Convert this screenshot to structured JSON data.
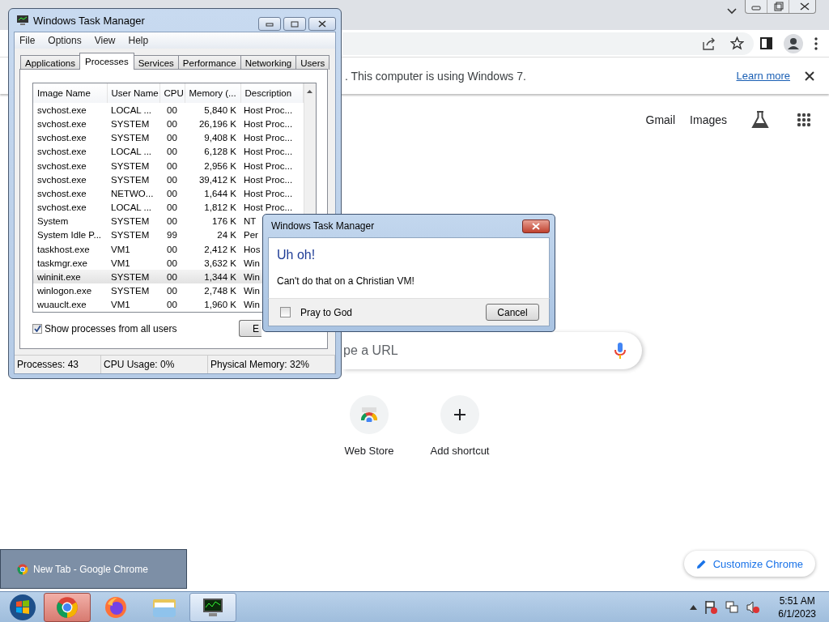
{
  "chrome": {
    "infobar": {
      "message": ". This computer is using Windows 7.",
      "link": "Learn more"
    },
    "top_links": [
      "Gmail",
      "Images"
    ],
    "search": {
      "placeholder": "pe a URL"
    },
    "shortcuts": [
      {
        "label": "Web Store",
        "kind": "webstore"
      },
      {
        "label": "Add shortcut",
        "kind": "add"
      }
    ],
    "customize_button": "Customize Chrome"
  },
  "task_manager": {
    "title": "Windows Task Manager",
    "menu": [
      "File",
      "Options",
      "View",
      "Help"
    ],
    "tabs": [
      {
        "label": "Applications",
        "selected": false
      },
      {
        "label": "Processes",
        "selected": true
      },
      {
        "label": "Services",
        "selected": false
      },
      {
        "label": "Performance",
        "selected": false
      },
      {
        "label": "Networking",
        "selected": false
      },
      {
        "label": "Users",
        "selected": false
      }
    ],
    "columns": [
      "Image Name",
      "User Name",
      "CPU",
      "Memory (...",
      "Description"
    ],
    "rows": [
      {
        "cells": [
          "svchost.exe",
          "LOCAL ...",
          "00",
          "5,840 K",
          "Host Proc..."
        ],
        "selected": false
      },
      {
        "cells": [
          "svchost.exe",
          "SYSTEM",
          "00",
          "26,196 K",
          "Host Proc..."
        ],
        "selected": false
      },
      {
        "cells": [
          "svchost.exe",
          "SYSTEM",
          "00",
          "9,408 K",
          "Host Proc..."
        ],
        "selected": false
      },
      {
        "cells": [
          "svchost.exe",
          "LOCAL ...",
          "00",
          "6,128 K",
          "Host Proc..."
        ],
        "selected": false
      },
      {
        "cells": [
          "svchost.exe",
          "SYSTEM",
          "00",
          "2,956 K",
          "Host Proc..."
        ],
        "selected": false
      },
      {
        "cells": [
          "svchost.exe",
          "SYSTEM",
          "00",
          "39,412 K",
          "Host Proc..."
        ],
        "selected": false
      },
      {
        "cells": [
          "svchost.exe",
          "NETWO...",
          "00",
          "1,644 K",
          "Host Proc..."
        ],
        "selected": false
      },
      {
        "cells": [
          "svchost.exe",
          "LOCAL ...",
          "00",
          "1,812 K",
          "Host Proc..."
        ],
        "selected": false
      },
      {
        "cells": [
          "System",
          "SYSTEM",
          "00",
          "176 K",
          "NT"
        ],
        "selected": false
      },
      {
        "cells": [
          "System Idle P...",
          "SYSTEM",
          "99",
          "24 K",
          "Per"
        ],
        "selected": false
      },
      {
        "cells": [
          "taskhost.exe",
          "VM1",
          "00",
          "2,412 K",
          "Hos"
        ],
        "selected": false
      },
      {
        "cells": [
          "taskmgr.exe",
          "VM1",
          "00",
          "3,632 K",
          "Win"
        ],
        "selected": false
      },
      {
        "cells": [
          "wininit.exe",
          "SYSTEM",
          "00",
          "1,344 K",
          "Win"
        ],
        "selected": true
      },
      {
        "cells": [
          "winlogon.exe",
          "SYSTEM",
          "00",
          "2,748 K",
          "Win"
        ],
        "selected": false
      },
      {
        "cells": [
          "wuauclt.exe",
          "VM1",
          "00",
          "1,960 K",
          "Win"
        ],
        "selected": false
      }
    ],
    "show_all_users": {
      "label": "Show processes from all users",
      "checked": true
    },
    "end_button": "E",
    "status": [
      "Processes: 43",
      "CPU Usage: 0%",
      "Physical Memory: 32%"
    ]
  },
  "dialog": {
    "title": "Windows Task Manager",
    "heading": "Uh oh!",
    "message": "Can't do that on a Christian VM!",
    "checkbox": {
      "label": "Pray to God",
      "checked": false
    },
    "button": "Cancel"
  },
  "taskbar": {
    "preview": "New Tab - Google Chrome",
    "apps": [
      {
        "kind": "chrome",
        "hovered": true,
        "open": false
      },
      {
        "kind": "firefox",
        "hovered": false,
        "open": false
      },
      {
        "kind": "explorer",
        "hovered": false,
        "open": false
      },
      {
        "kind": "taskmgr",
        "hovered": false,
        "open": true
      }
    ],
    "time": "5:51 AM",
    "date": "6/1/2023"
  }
}
